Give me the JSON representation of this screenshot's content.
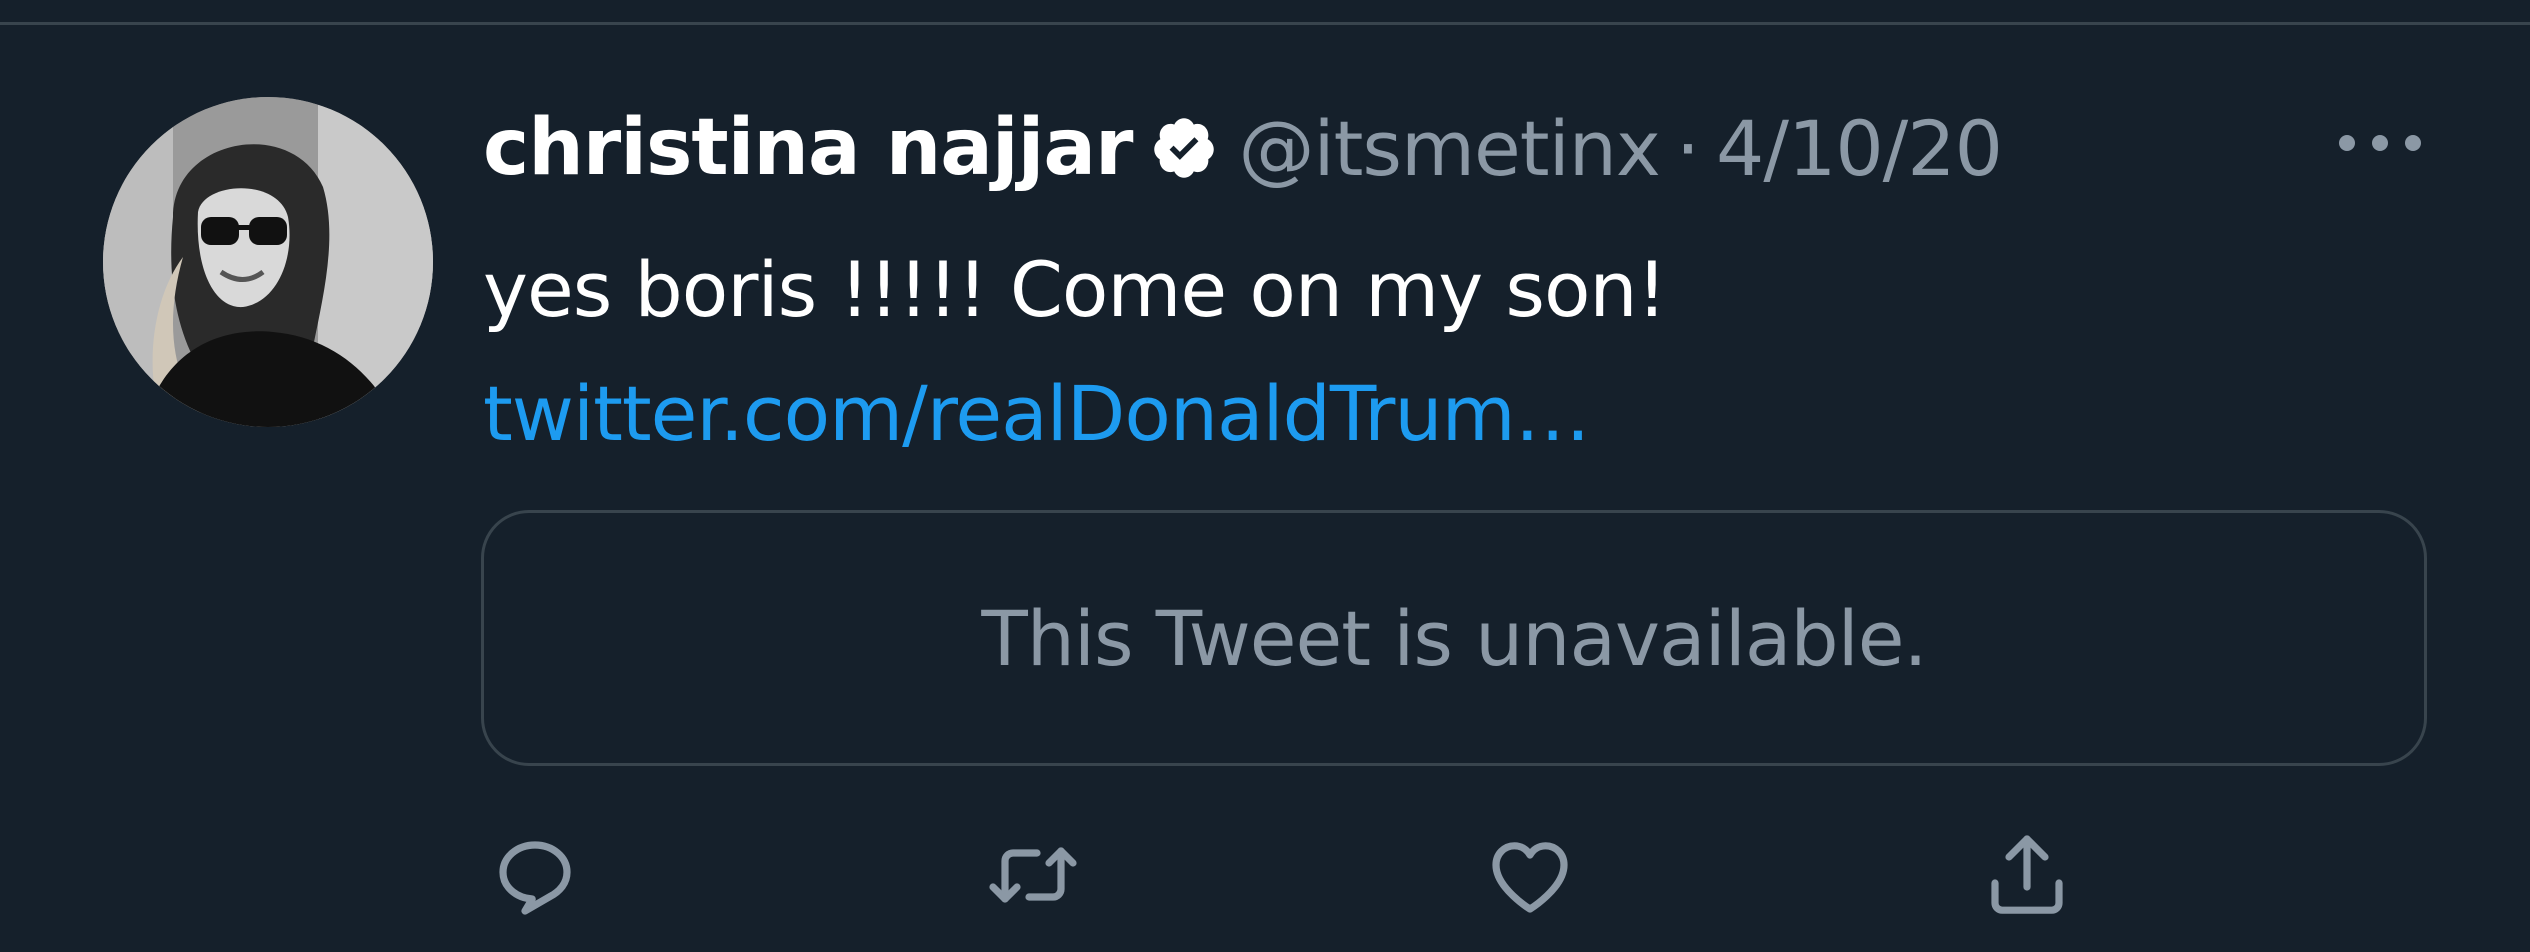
{
  "tweet": {
    "display_name": "christina najjar",
    "handle": "@itsmetinx",
    "separator": "·",
    "date": "4/10/20",
    "text": "yes boris !!!!! Come on my son! ",
    "link_text": "twitter.com/realDonaldTrum…",
    "quoted_unavailable": "This Tweet is unavailable."
  },
  "icons": {
    "verified": "verified-badge-icon",
    "more": "more-options-icon",
    "reply": "reply-icon",
    "retweet": "retweet-icon",
    "like": "heart-icon",
    "share": "share-icon"
  },
  "colors": {
    "background": "#15202b",
    "link": "#1d9bf0",
    "secondary_text": "#8b98a5",
    "border": "#38444d"
  }
}
